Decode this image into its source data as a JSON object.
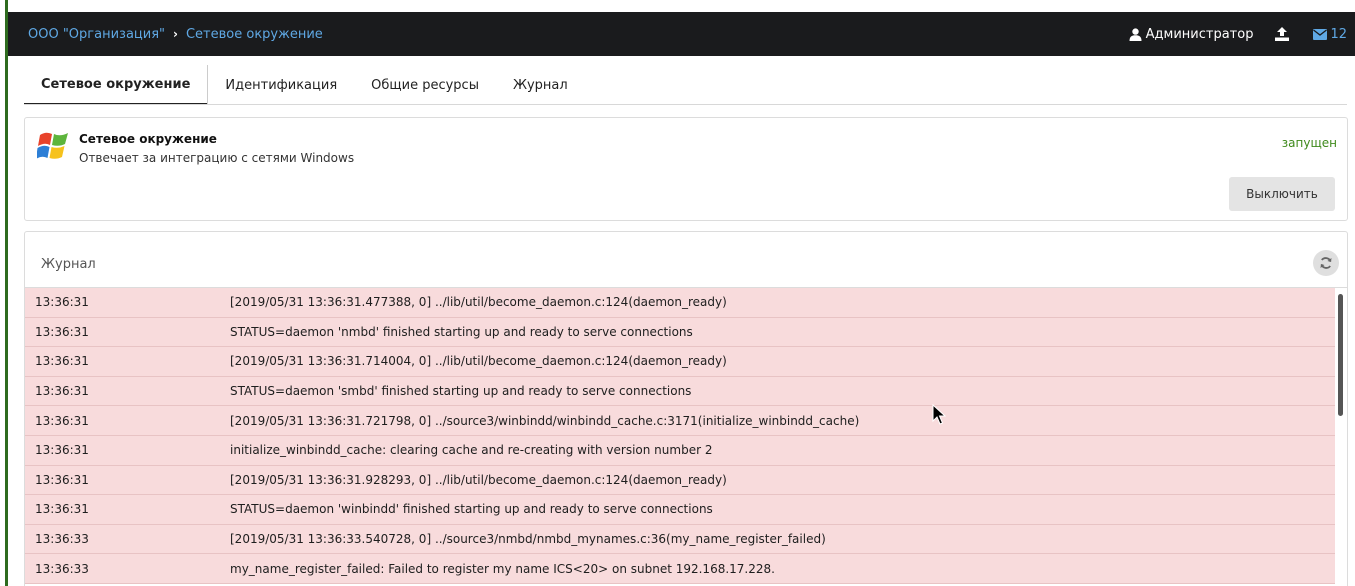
{
  "header": {
    "org": "ООО \"Организация\"",
    "separator": "›",
    "current": "Сетевое окружение",
    "user_name": "Администратор",
    "mail_count": "12"
  },
  "tabs": [
    {
      "label": "Сетевое окружение",
      "active": true
    },
    {
      "label": "Идентификация",
      "active": false
    },
    {
      "label": "Общие ресурсы",
      "active": false
    },
    {
      "label": "Журнал",
      "active": false
    }
  ],
  "service": {
    "title": "Сетевое окружение",
    "description": "Отвечает за интеграцию с сетями Windows",
    "status": "запущен",
    "button_label": "Выключить",
    "status_color": "#3f8a1c"
  },
  "log": {
    "title": "Журнал",
    "rows": [
      {
        "time": "13:36:31",
        "message": "[2019/05/31 13:36:31.477388, 0] ../lib/util/become_daemon.c:124(daemon_ready)"
      },
      {
        "time": "13:36:31",
        "message": "STATUS=daemon 'nmbd' finished starting up and ready to serve connections"
      },
      {
        "time": "13:36:31",
        "message": "[2019/05/31 13:36:31.714004, 0] ../lib/util/become_daemon.c:124(daemon_ready)"
      },
      {
        "time": "13:36:31",
        "message": "STATUS=daemon 'smbd' finished starting up and ready to serve connections"
      },
      {
        "time": "13:36:31",
        "message": "[2019/05/31 13:36:31.721798, 0] ../source3/winbindd/winbindd_cache.c:3171(initialize_winbindd_cache)"
      },
      {
        "time": "13:36:31",
        "message": "initialize_winbindd_cache: clearing cache and re-creating with version number 2"
      },
      {
        "time": "13:36:31",
        "message": "[2019/05/31 13:36:31.928293, 0] ../lib/util/become_daemon.c:124(daemon_ready)"
      },
      {
        "time": "13:36:31",
        "message": "STATUS=daemon 'winbindd' finished starting up and ready to serve connections"
      },
      {
        "time": "13:36:33",
        "message": "[2019/05/31 13:36:33.540728, 0] ../source3/nmbd/nmbd_mynames.c:36(my_name_register_failed)"
      },
      {
        "time": "13:36:33",
        "message": "my_name_register_failed: Failed to register my name ICS<20> on subnet 192.168.17.228."
      }
    ]
  },
  "icons": {
    "user": "user-icon",
    "upload": "upload-icon",
    "mail": "envelope-icon",
    "refresh": "refresh-icon",
    "service_logo": "windows-logo-icon"
  },
  "colors": {
    "topbar_bg": "#1a1b1d",
    "link": "#5fa8e4",
    "log_row_bg": "#f8dbdc"
  }
}
